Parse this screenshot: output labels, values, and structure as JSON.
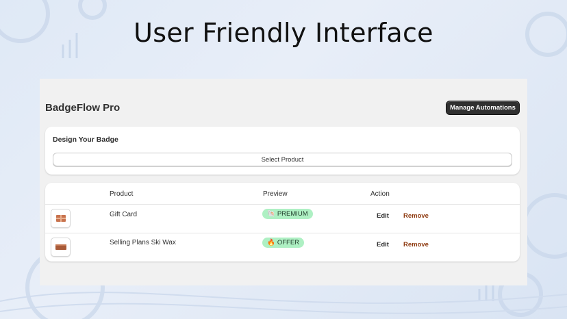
{
  "headline": "User Friendly Interface",
  "app": {
    "title": "BadgeFlow Pro",
    "manage_label": "Manage Automations"
  },
  "design_card": {
    "title": "Design Your Badge",
    "select_label": "Select Product"
  },
  "table": {
    "headers": {
      "product": "Product",
      "preview": "Preview",
      "action": "Action"
    },
    "rows": [
      {
        "product": "Gift Card",
        "badge_icon": "🐚",
        "badge": "PREMIUM",
        "edit": "Edit",
        "remove": "Remove"
      },
      {
        "product": "Selling Plans Ski Wax",
        "badge_icon": "🔥",
        "badge": "OFFER",
        "edit": "Edit",
        "remove": "Remove"
      }
    ]
  },
  "colors": {
    "badge_bg": "#aef0c3",
    "remove_text": "#8e3a10",
    "primary_button": "#303030"
  }
}
